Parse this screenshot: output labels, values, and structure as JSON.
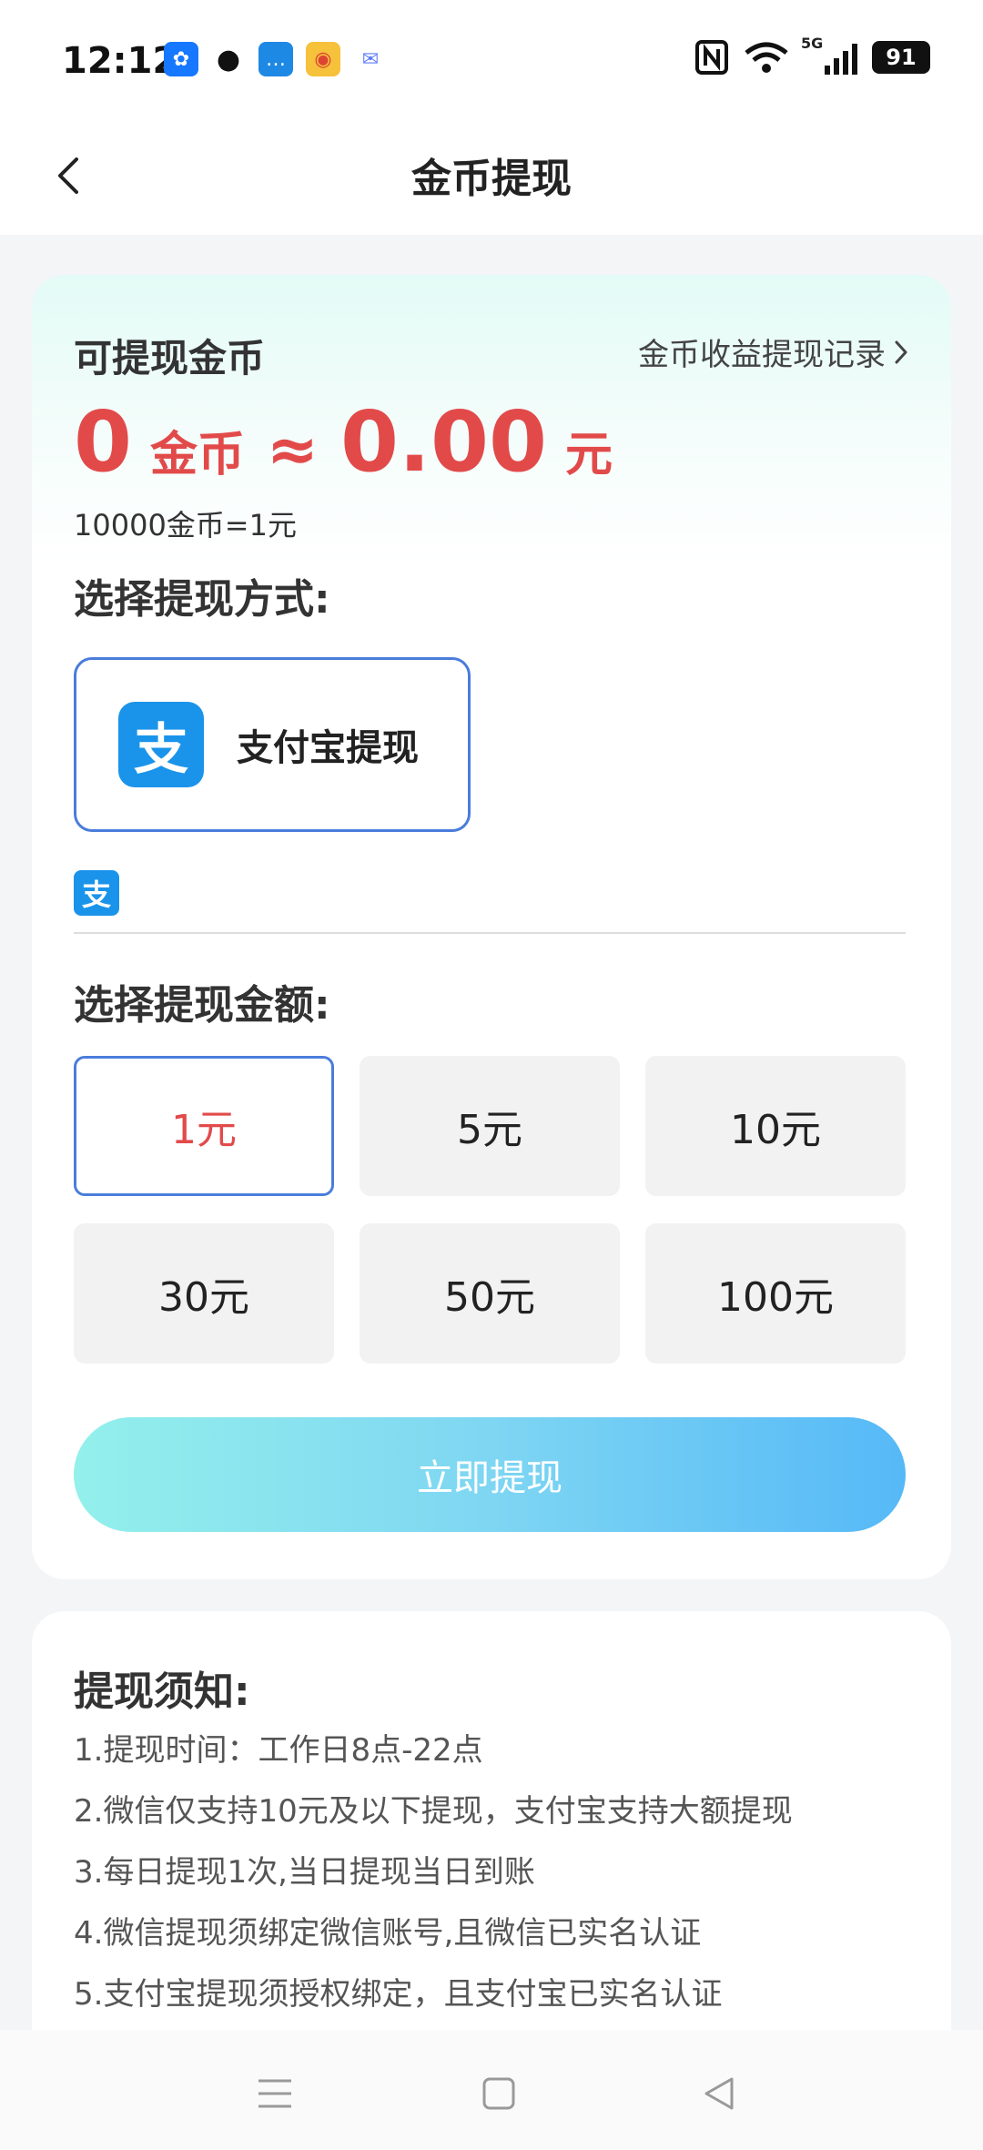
{
  "status_bar": {
    "time": "12:12",
    "battery": "91",
    "network": "5G"
  },
  "header": {
    "title": "金币提现"
  },
  "balance": {
    "label": "可提现金币",
    "records_link": "金币收益提现记录",
    "coins": "0",
    "coin_unit": "金币",
    "approx": "≈",
    "yuan": "0.00",
    "yuan_unit": "元",
    "rate": "10000金币=1元"
  },
  "method": {
    "title": "选择提现方式:",
    "option_label": "支付宝提现",
    "logo_char": "支"
  },
  "amount": {
    "title": "选择提现金额:",
    "options": [
      "1元",
      "5元",
      "10元",
      "30元",
      "50元",
      "100元"
    ],
    "selected_index": 0
  },
  "submit": {
    "label": "立即提现"
  },
  "notice": {
    "title": "提现须知:",
    "items": [
      "1.提现时间：工作日8点-22点",
      "2.微信仅支持10元及以下提现，支付宝支持大额提现",
      "3.每日提现1次,当日提现当日到账",
      "4.微信提现须绑定微信账号,且微信已实名认证",
      "5.支付宝提现须授权绑定，且支付宝已实名认证"
    ]
  },
  "colors": {
    "accent_red": "#e24a4a",
    "accent_blue": "#4a7ddb",
    "alipay_blue": "#1a94ea"
  }
}
